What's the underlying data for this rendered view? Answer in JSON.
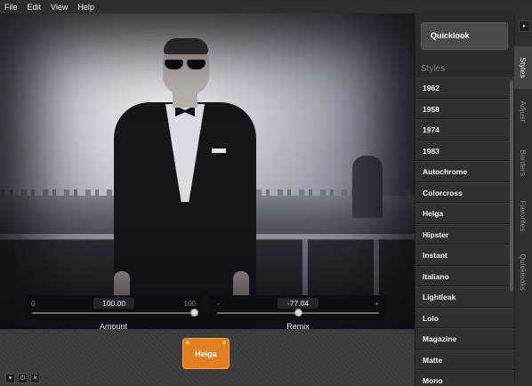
{
  "menu": [
    "File",
    "Edit",
    "View",
    "Help"
  ],
  "sliders": {
    "amount": {
      "min": "0",
      "max": "100",
      "value": "100.00",
      "caption": "Amount",
      "level": 1.0
    },
    "remix": {
      "min": "-",
      "max": "+",
      "value": "-77.04",
      "caption": "Remix",
      "level": 0.5
    }
  },
  "selected_style_chip": "Helga",
  "panel": {
    "quicklook_label": "Quicklook",
    "styles_heading": "Styles",
    "styles": [
      "1962",
      "1958",
      "1974",
      "1983",
      "Autochrome",
      "Colorcross",
      "Helga",
      "Hipster",
      "Instant",
      "Italiano",
      "Lightleak",
      "Lolo",
      "Magazine",
      "Matte",
      "Mono"
    ]
  },
  "tabs": [
    "Styles",
    "Adjust",
    "Borders",
    "Favorites",
    "Quicklooks"
  ],
  "active_tab": "Styles",
  "controls": {
    "menu_icon": "▾",
    "power_icon": "⏻",
    "close_icon": "✕",
    "expand_icon": "▸"
  },
  "colors": {
    "accent_orange": "#e37e20",
    "panel_bg": "#2b2b2b",
    "slider_bg": "#0e0e10"
  }
}
